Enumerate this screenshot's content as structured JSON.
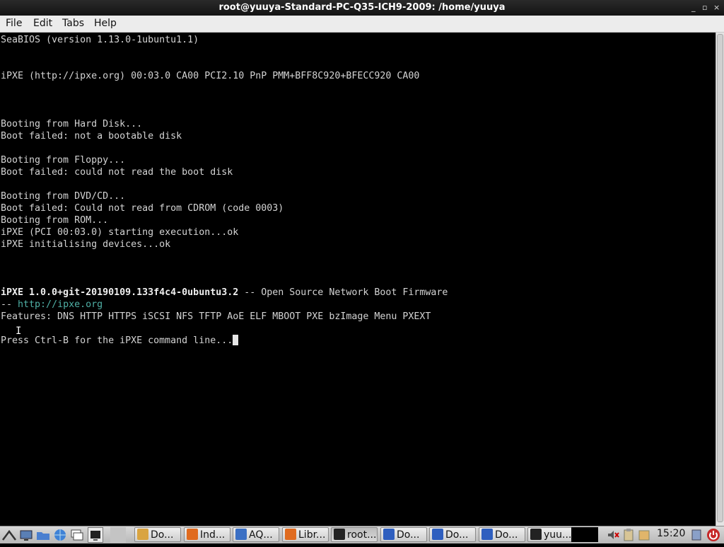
{
  "window": {
    "title": "root@yuuya-Standard-PC-Q35-ICH9-2009: /home/yuuya",
    "controls": [
      "_",
      "▫",
      "×"
    ]
  },
  "menu": [
    "File",
    "Edit",
    "Tabs",
    "Help"
  ],
  "terminal": {
    "lines": [
      "SeaBIOS (version 1.13.0-1ubuntu1.1)",
      "",
      "",
      "iPXE (http://ipxe.org) 00:03.0 CA00 PCI2.10 PnP PMM+BFF8C920+BFECC920 CA00",
      "",
      "",
      "",
      "Booting from Hard Disk...",
      "Boot failed: not a bootable disk",
      "",
      "Booting from Floppy...",
      "Boot failed: could not read the boot disk",
      "",
      "Booting from DVD/CD...",
      "Boot failed: Could not read from CDROM (code 0003)",
      "Booting from ROM...",
      "iPXE (PCI 00:03.0) starting execution...ok",
      "iPXE initialising devices...ok",
      "",
      "",
      ""
    ],
    "banner_bold": "iPXE 1.0.0+git-20190109.133f4c4-0ubuntu3.2",
    "banner_rest": " -- Open Source Network Boot Firmware",
    "link_prefix": "-- ",
    "link": "http://ipxe.org",
    "features": "Features: DNS HTTP HTTPS iSCSI NFS TFTP AoE ELF MBOOT PXE bzImage Menu PXEXT",
    "prompt": "Press Ctrl-B for the iPXE command line..."
  },
  "taskbar": {
    "tasks": [
      {
        "label": "Do...",
        "icon": "folder-icon",
        "color": "#d9a441"
      },
      {
        "label": "Ind...",
        "icon": "firefox-icon",
        "color": "#e06b1f"
      },
      {
        "label": "AQ...",
        "icon": "browser-icon",
        "color": "#3a6fc4"
      },
      {
        "label": "Libr...",
        "icon": "firefox-icon",
        "color": "#e06b1f"
      },
      {
        "label": "root...",
        "icon": "terminal-icon",
        "color": "#222222",
        "active": true
      },
      {
        "label": "Do...",
        "icon": "document-icon",
        "color": "#2f5fbf"
      },
      {
        "label": "Do...",
        "icon": "document-icon",
        "color": "#2f5fbf"
      },
      {
        "label": "Do...",
        "icon": "document-icon",
        "color": "#2f5fbf"
      },
      {
        "label": "yuu...",
        "icon": "terminal-icon",
        "color": "#222222"
      }
    ],
    "clock": "15:20"
  }
}
